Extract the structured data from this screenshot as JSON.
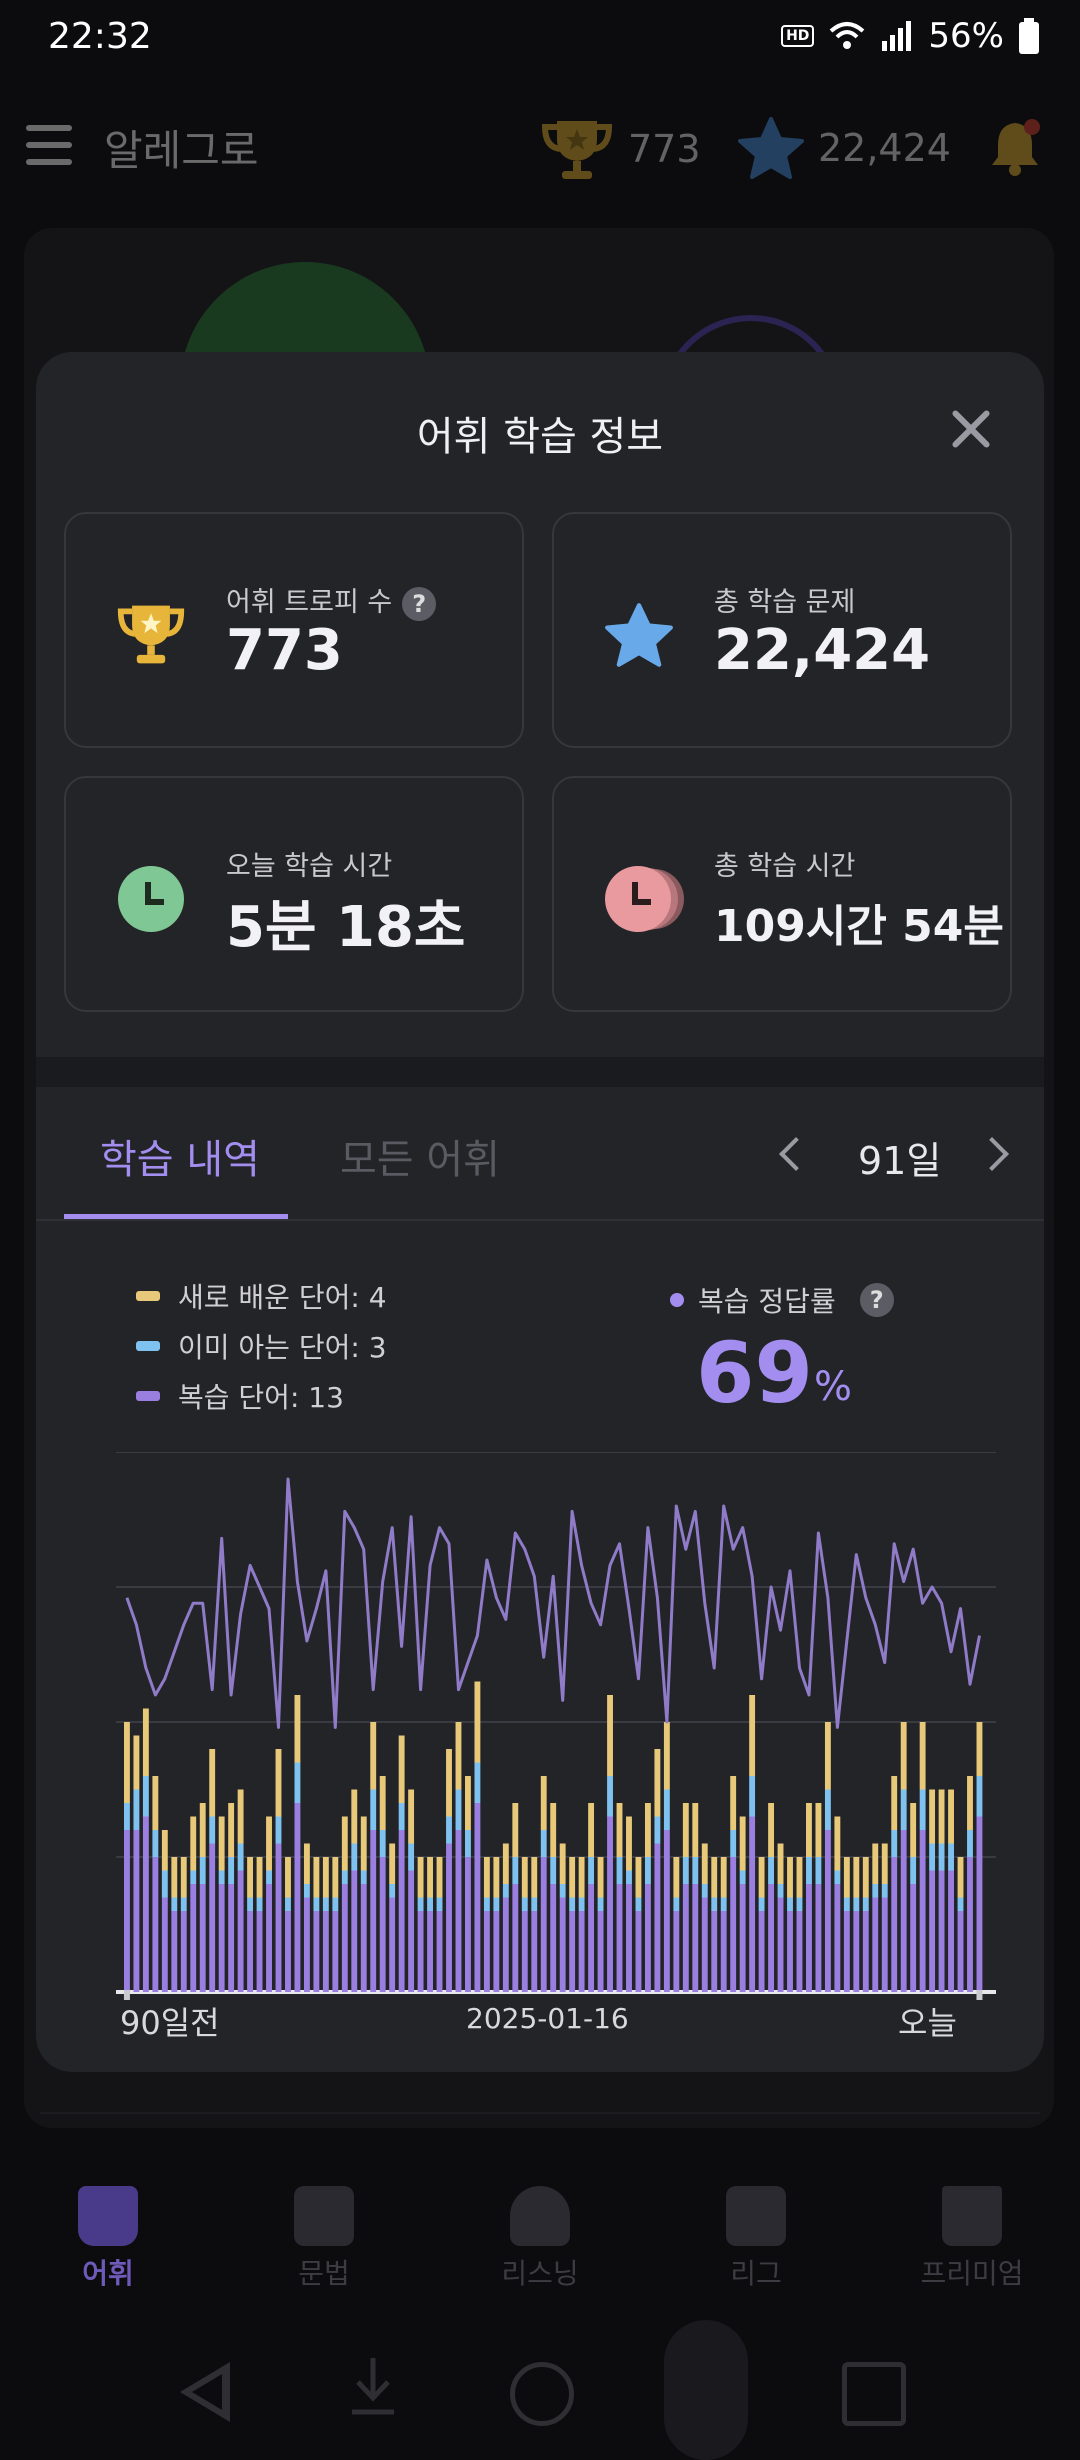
{
  "status_bar": {
    "time": "22:32",
    "hd_voice": "HD",
    "battery": "56%"
  },
  "app_bar": {
    "title": "알레그로",
    "trophies": "773",
    "stars": "22,424"
  },
  "modal": {
    "title": "어휘 학습 정보",
    "cards": {
      "trophy": {
        "label": "어휘 트로피 수",
        "help": "?",
        "value": "773"
      },
      "problems": {
        "label": "총 학습 문제",
        "value": "22,424"
      },
      "today": {
        "label": "오늘 학습 시간",
        "value": "5분 18초"
      },
      "total": {
        "label": "총 학습 시간",
        "value": "109시간 54분"
      }
    },
    "tabs": {
      "history": "학습 내역",
      "all_words": "모든 어휘"
    },
    "period": "91일",
    "legend": {
      "new": "새로 배운 단어: 4",
      "known": "이미 아는 단어: 3",
      "review": "복습 단어: 13"
    },
    "accuracy": {
      "label": "복습 정답률",
      "help": "?",
      "value": "69",
      "unit": "%"
    },
    "x_labels": {
      "start": "90일전",
      "mid": "2025-01-16",
      "end": "오늘"
    }
  },
  "colors": {
    "accent": "#a38ef0",
    "new": "#e8c97a",
    "known": "#7fc2ef",
    "review": "#9b7fe0",
    "trophy": "#e7b53a",
    "star": "#68a9ea",
    "clock_today": "#7fc794",
    "clock_total": "#e89a9e"
  },
  "bottom_nav": {
    "items": [
      {
        "label": "어휘",
        "icon": "book-icon"
      },
      {
        "label": "문법",
        "icon": "grammar-icon"
      },
      {
        "label": "리스닝",
        "icon": "headphones-icon"
      },
      {
        "label": "리그",
        "icon": "league-icon"
      },
      {
        "label": "프리미엄",
        "icon": "crown-icon"
      }
    ]
  },
  "chart_data": {
    "type": "bar",
    "stacked": true,
    "x_range_days": [
      -90,
      0
    ],
    "ylim": [
      0,
      40
    ],
    "series": [
      {
        "name": "복습 단어",
        "color": "#9b7fe0",
        "values": [
          12,
          12,
          13,
          10,
          7,
          6,
          6,
          8,
          8,
          11,
          8,
          8,
          9,
          6,
          6,
          8,
          11,
          6,
          14,
          7,
          6,
          6,
          6,
          8,
          9,
          8,
          12,
          10,
          7,
          12,
          9,
          6,
          6,
          6,
          11,
          12,
          10,
          14,
          6,
          6,
          7,
          8,
          6,
          6,
          10,
          8,
          7,
          6,
          6,
          8,
          6,
          13,
          8,
          8,
          6,
          8,
          11,
          12,
          6,
          8,
          8,
          7,
          6,
          6,
          10,
          8,
          13,
          6,
          8,
          7,
          6,
          6,
          8,
          8,
          12,
          8,
          6,
          6,
          6,
          7,
          7,
          10,
          12,
          8,
          12,
          9,
          9,
          9,
          6,
          10,
          13
        ]
      },
      {
        "name": "이미 아는 단어",
        "color": "#7fc2ef",
        "values": [
          2,
          3,
          3,
          2,
          2,
          1,
          1,
          1,
          2,
          2,
          1,
          2,
          2,
          1,
          1,
          1,
          2,
          1,
          3,
          1,
          1,
          1,
          1,
          1,
          2,
          1,
          3,
          2,
          1,
          2,
          2,
          1,
          1,
          1,
          2,
          3,
          2,
          3,
          1,
          1,
          1,
          2,
          1,
          1,
          2,
          2,
          1,
          1,
          1,
          2,
          1,
          3,
          2,
          1,
          1,
          2,
          2,
          3,
          1,
          2,
          2,
          1,
          1,
          1,
          2,
          1,
          3,
          1,
          2,
          1,
          1,
          1,
          2,
          2,
          3,
          1,
          1,
          1,
          1,
          1,
          1,
          2,
          3,
          2,
          3,
          2,
          2,
          2,
          1,
          2,
          3
        ]
      },
      {
        "name": "새로 배운 단어",
        "color": "#e8c97a",
        "values": [
          6,
          4,
          5,
          4,
          3,
          3,
          3,
          4,
          4,
          5,
          4,
          4,
          4,
          3,
          3,
          4,
          5,
          3,
          5,
          3,
          3,
          3,
          3,
          4,
          4,
          4,
          5,
          4,
          3,
          5,
          4,
          3,
          3,
          3,
          5,
          5,
          4,
          6,
          3,
          3,
          3,
          4,
          3,
          3,
          4,
          4,
          3,
          3,
          3,
          4,
          3,
          6,
          4,
          4,
          3,
          4,
          5,
          5,
          3,
          4,
          4,
          3,
          3,
          3,
          4,
          4,
          6,
          3,
          4,
          3,
          3,
          3,
          4,
          4,
          5,
          4,
          3,
          3,
          3,
          3,
          3,
          4,
          5,
          4,
          5,
          4,
          4,
          4,
          3,
          4,
          4
        ]
      }
    ],
    "accuracy_line": {
      "name": "복습 정답률",
      "color": "#9b7fe0",
      "ylim": [
        0,
        100
      ],
      "values": [
        73,
        68,
        60,
        55,
        58,
        63,
        68,
        72,
        72,
        56,
        84,
        55,
        70,
        79,
        75,
        71,
        49,
        95,
        76,
        65,
        71,
        78,
        49,
        89,
        86,
        82,
        56,
        76,
        86,
        64,
        88,
        56,
        79,
        86,
        83,
        56,
        61,
        66,
        80,
        73,
        69,
        85,
        82,
        77,
        62,
        77,
        54,
        89,
        79,
        72,
        68,
        79,
        83,
        71,
        58,
        86,
        73,
        50,
        90,
        82,
        89,
        72,
        60,
        90,
        82,
        86,
        77,
        58,
        75,
        67,
        78,
        60,
        55,
        85,
        73,
        49,
        65,
        81,
        73,
        68,
        61,
        83,
        76,
        82,
        72,
        75,
        72,
        63,
        71,
        57,
        66
      ]
    },
    "xlabel": "",
    "ylabel": ""
  }
}
